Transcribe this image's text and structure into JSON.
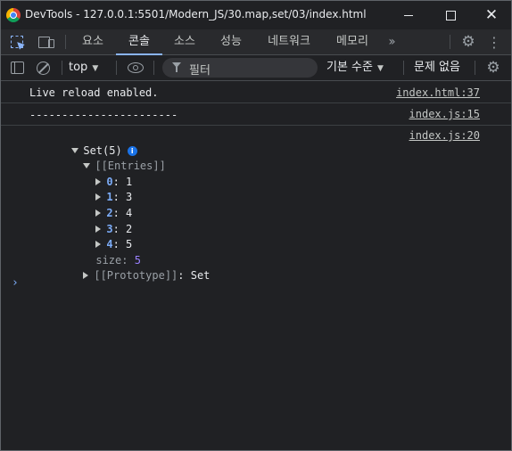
{
  "window": {
    "title": "DevTools - 127.0.0.1:5501/Modern_JS/30.map,set/03/index.html"
  },
  "tabs": [
    {
      "label": "요소",
      "active": false
    },
    {
      "label": "콘솔",
      "active": true
    },
    {
      "label": "소스",
      "active": false
    },
    {
      "label": "성능",
      "active": false
    },
    {
      "label": "네트워크",
      "active": false
    },
    {
      "label": "메모리",
      "active": false
    }
  ],
  "toolbar": {
    "context": "top",
    "filter_placeholder": "필터",
    "levels": "기본 수준",
    "issues": "문제 없음"
  },
  "console": {
    "messages": [
      {
        "text": "Live reload enabled.",
        "source": "index.html:37"
      },
      {
        "text": "-----------------------",
        "source": "index.js:15"
      }
    ],
    "log": {
      "source": "index.js:20",
      "summary": "Set(5)",
      "info_icon": "i",
      "entries_label": "[[Entries]]",
      "entries": [
        {
          "index": "0",
          "value": "1"
        },
        {
          "index": "1",
          "value": "3"
        },
        {
          "index": "2",
          "value": "4"
        },
        {
          "index": "3",
          "value": "2"
        },
        {
          "index": "4",
          "value": "5"
        }
      ],
      "size_label": "size",
      "size_value": "5",
      "prototype_label": "[[Prototype]]",
      "prototype_value": "Set"
    },
    "prompt": "›"
  }
}
